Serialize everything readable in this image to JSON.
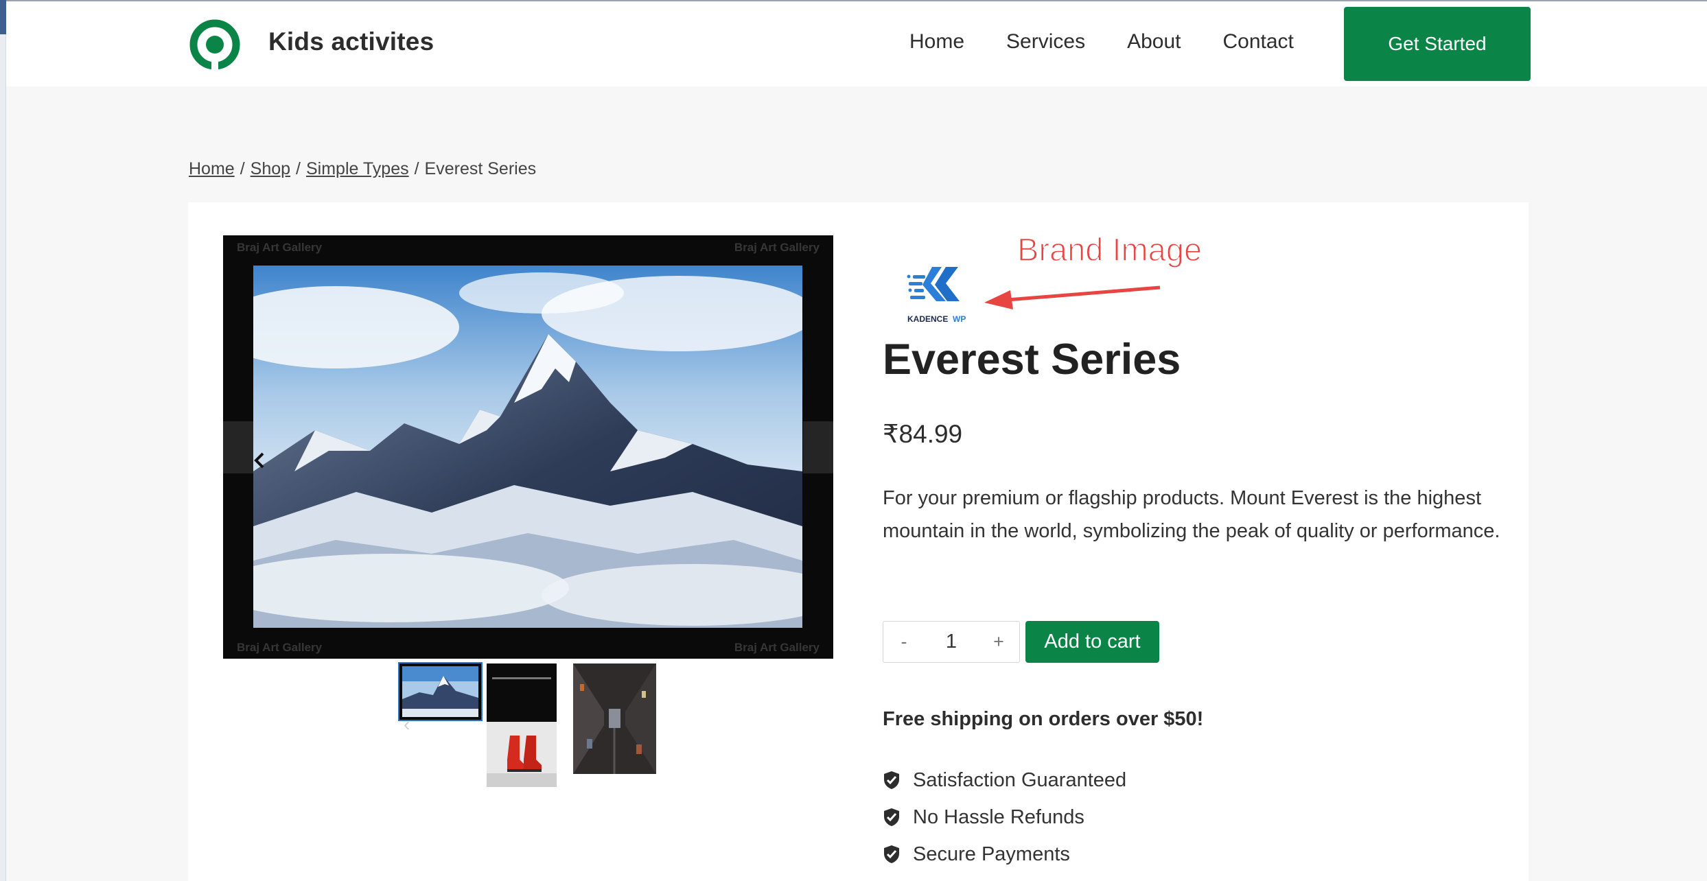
{
  "header": {
    "site_title": "Kids activites",
    "nav": [
      "Home",
      "Services",
      "About",
      "Contact"
    ],
    "cta_label": "Get Started",
    "brand_color": "#0b8547"
  },
  "breadcrumb": {
    "items": [
      "Home",
      "Shop",
      "Simple Types"
    ],
    "current": "Everest Series",
    "separator": "/"
  },
  "gallery": {
    "watermark": "Braj Art Gallery",
    "prev_icon": "chevron-left-icon",
    "next_icon": "chevron-right-icon",
    "thumbnails": [
      "everest-mountain-thumbnail",
      "red-boots-thumbnail",
      "city-street-thumbnail"
    ],
    "thumbnail_prev": "‹"
  },
  "annotation": {
    "label": "Brand Image",
    "color": "#e64541"
  },
  "brand": {
    "wordmark": "KADENCE",
    "suffix": "WP",
    "color": "#2b7fd8"
  },
  "product": {
    "title": "Everest Series",
    "price": "₹84.99",
    "description": "For your premium or flagship products. Mount Everest is the highest mountain in the world, symbolizing the peak of quality or performance.",
    "quantity": "1",
    "minus_label": "-",
    "plus_label": "+",
    "add_to_cart_label": "Add to cart",
    "shipping_note": "Free shipping on orders over $50!",
    "features": [
      "Satisfaction Guaranteed",
      "No Hassle Refunds",
      "Secure Payments"
    ]
  }
}
